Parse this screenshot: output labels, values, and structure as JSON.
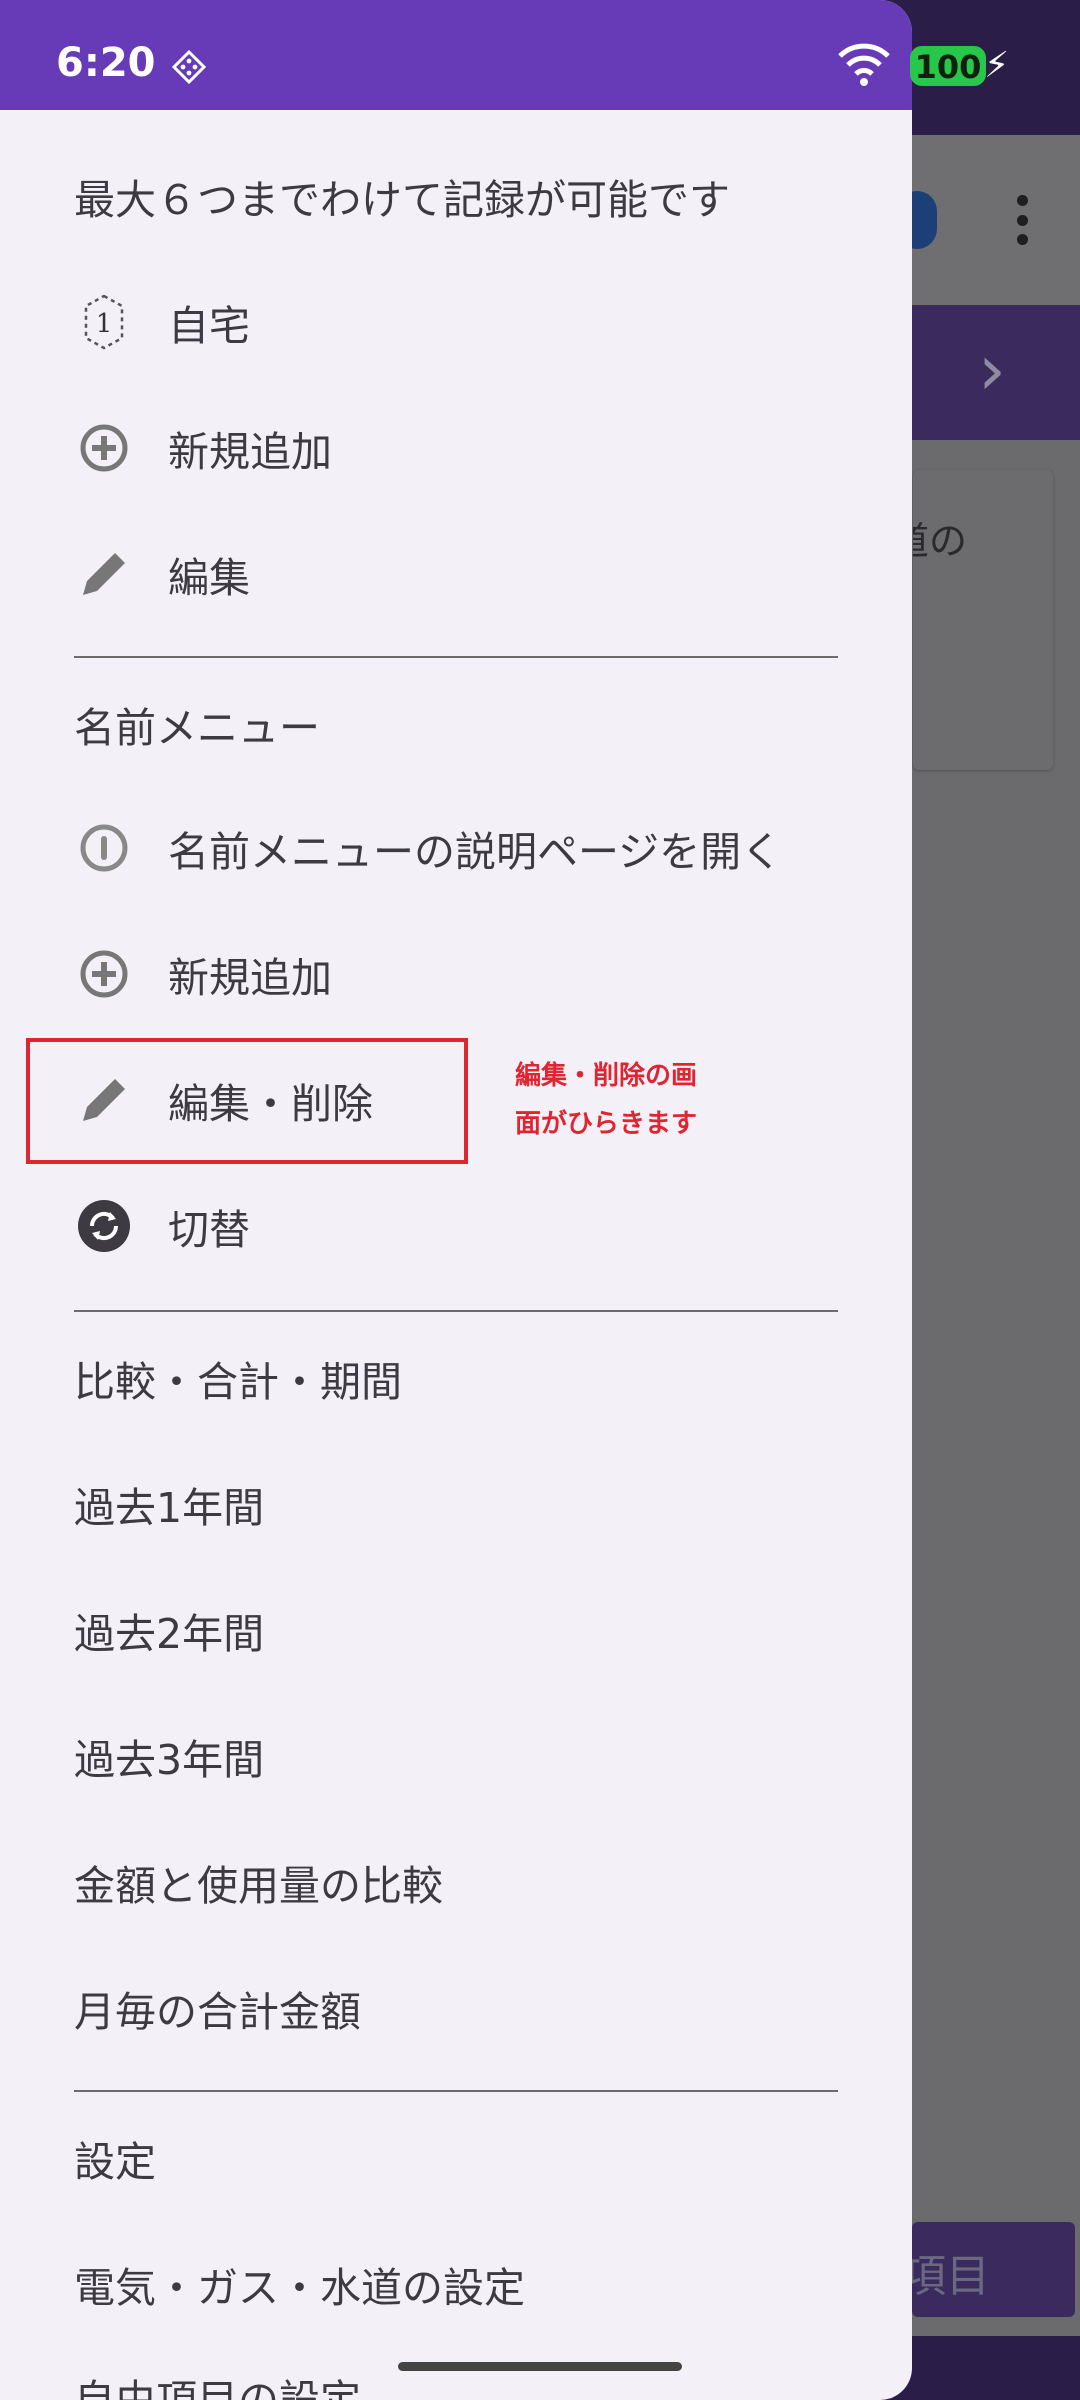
{
  "status_bar": {
    "time": "6:20",
    "battery": "100"
  },
  "background": {
    "card_text": "水道の",
    "button_text": "項目"
  },
  "drawer": {
    "section_multi": {
      "header": "最大６つまでわけて記録が可能です",
      "items": [
        {
          "label": "自宅",
          "icon": "number-one-icon"
        },
        {
          "label": "新規追加",
          "icon": "add-circle-icon"
        },
        {
          "label": "編集",
          "icon": "pencil-icon"
        }
      ]
    },
    "section_name": {
      "header": "名前メニュー",
      "items": [
        {
          "label": "名前メニューの説明ページを開く",
          "icon": "info-icon"
        },
        {
          "label": "新規追加",
          "icon": "add-circle-icon"
        },
        {
          "label": "編集・削除",
          "icon": "pencil-icon"
        },
        {
          "label": "切替",
          "icon": "sync-icon"
        }
      ]
    },
    "section_compare": {
      "header": "比較・合計・期間",
      "items": [
        {
          "label": "過去1年間"
        },
        {
          "label": "過去2年間"
        },
        {
          "label": "過去3年間"
        },
        {
          "label": "金額と使用量の比較"
        },
        {
          "label": "月毎の合計金額"
        }
      ]
    },
    "section_settings": {
      "header": "設定",
      "items": [
        {
          "label": "電気・ガス・水道の設定"
        },
        {
          "label": "自由項目の設定"
        }
      ]
    }
  },
  "annotation": {
    "text_line1": "編集・削除の画",
    "text_line2": "面がひらきます",
    "color": "#e02430"
  },
  "colors": {
    "status_bar": "#673ab7",
    "drawer_bg": "#f4f0f7",
    "text": "#3d3a42"
  }
}
